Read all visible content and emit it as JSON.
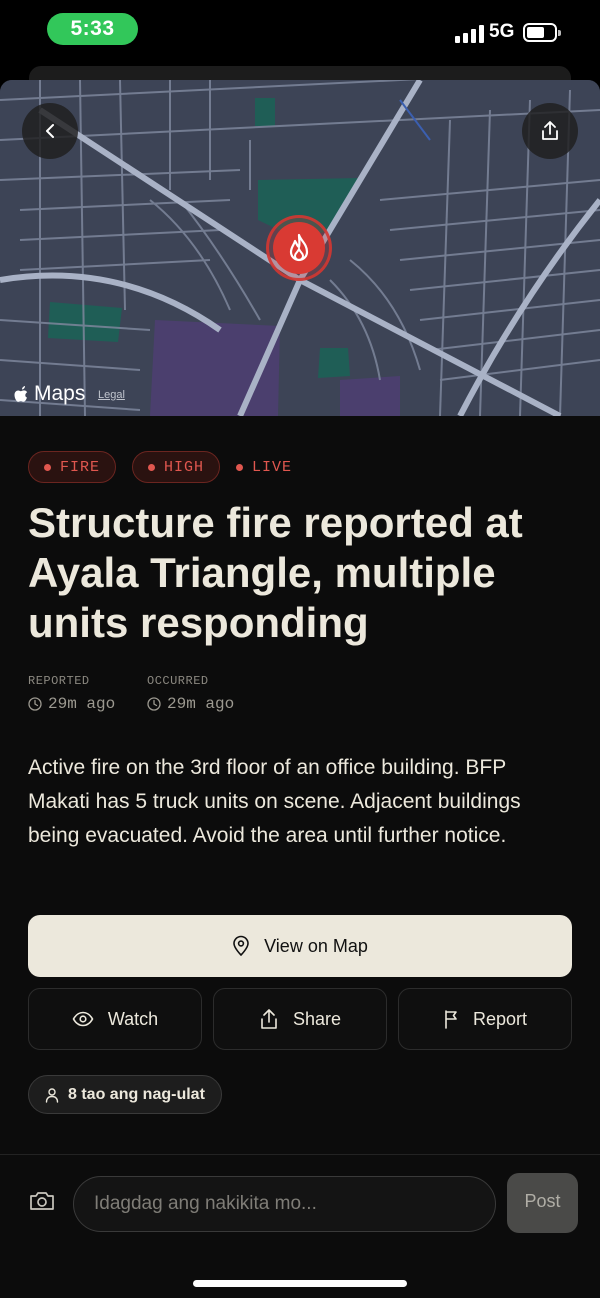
{
  "status_bar": {
    "time": "5:33",
    "network": "5G"
  },
  "map": {
    "brand": "Maps",
    "legal": "Legal"
  },
  "tags": [
    {
      "label": "FIRE"
    },
    {
      "label": "HIGH"
    }
  ],
  "live_label": "LIVE",
  "title": "Structure fire reported at Ayala Triangle, multiple units responding",
  "meta": {
    "reported_label": "REPORTED",
    "reported_value": "29m ago",
    "occurred_label": "OCCURRED",
    "occurred_value": "29m ago"
  },
  "description": "Active fire on the 3rd floor of an office building. BFP Makati has 5 truck units on scene. Adjacent buildings being evacuated. Avoid the area until further notice.",
  "actions": {
    "view_on_map": "View on Map",
    "watch": "Watch",
    "share": "Share",
    "report": "Report"
  },
  "reporters": "8 tao ang nag-ulat",
  "composer": {
    "placeholder": "Idagdag ang nakikita mo...",
    "post": "Post"
  },
  "colors": {
    "accent_fire": "#d93a33",
    "tag_text": "#e0574f",
    "primary_button": "#ece8dc",
    "background": "#0c0c0c"
  }
}
